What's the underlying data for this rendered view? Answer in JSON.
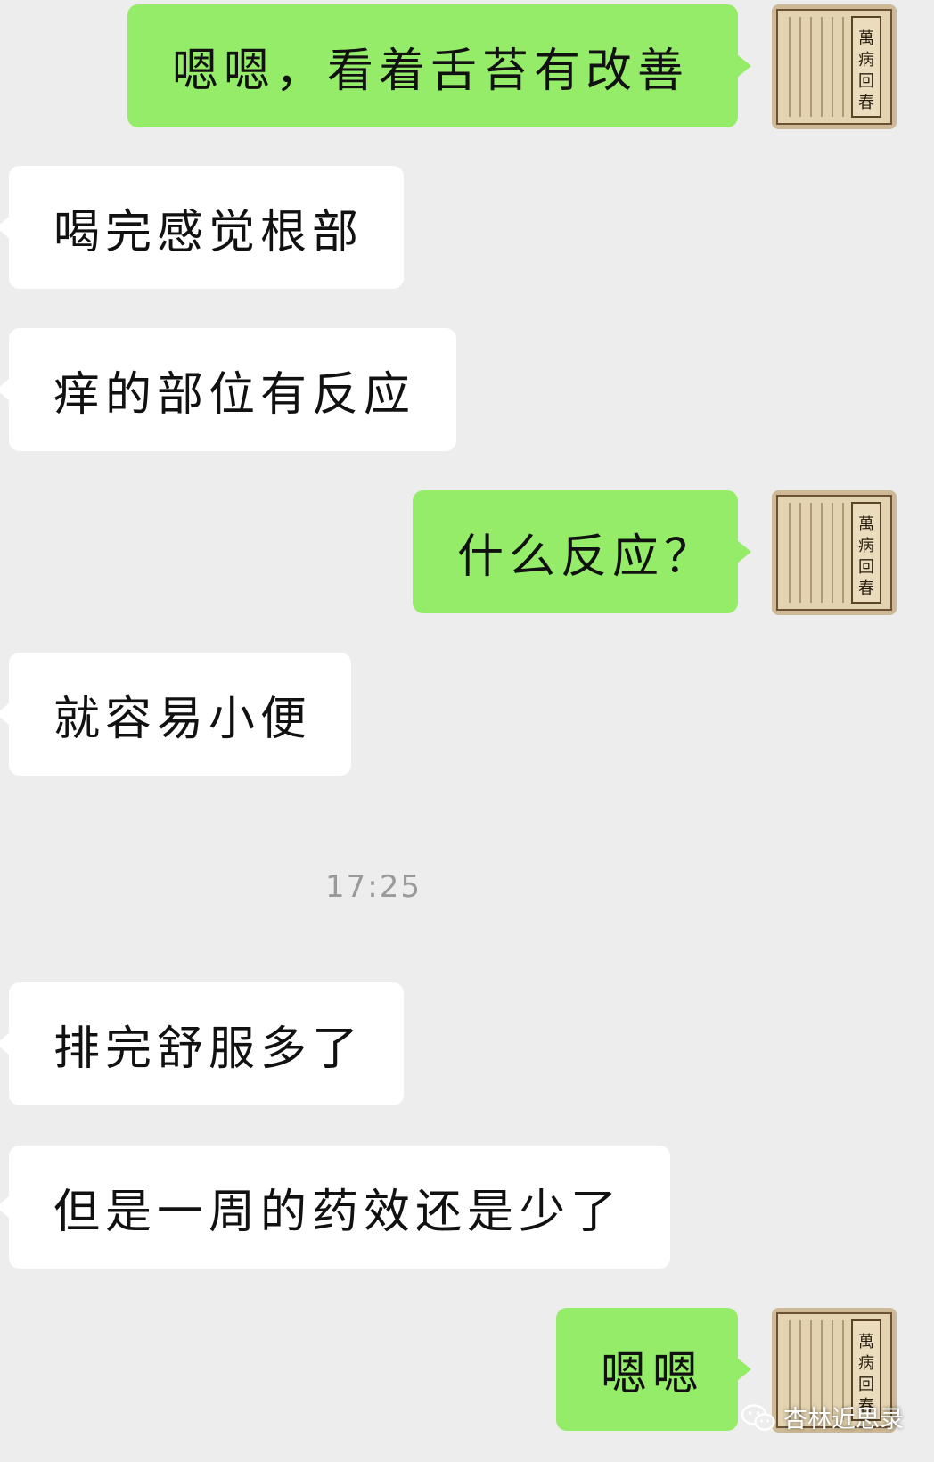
{
  "messages": [
    {
      "side": "outgoing",
      "text": "嗯嗯，看着舌苔有改善"
    },
    {
      "side": "incoming",
      "text": "喝完感觉根部"
    },
    {
      "side": "incoming",
      "text": "痒的部位有反应"
    },
    {
      "side": "outgoing",
      "text": "什么反应？"
    },
    {
      "side": "incoming",
      "text": "就容易小便"
    },
    {
      "side": "incoming",
      "text": "排完舒服多了"
    },
    {
      "side": "incoming",
      "text": "但是一周的药效还是少了"
    },
    {
      "side": "outgoing",
      "text": "嗯嗯"
    }
  ],
  "timestamp": "17:25",
  "avatar": {
    "book_title": "萬病回春"
  },
  "watermark": {
    "text": "杏林近思录",
    "icon": "wechat-icon"
  },
  "colors": {
    "background": "#ededed",
    "outgoing_bubble": "#95ec69",
    "incoming_bubble": "#ffffff"
  }
}
